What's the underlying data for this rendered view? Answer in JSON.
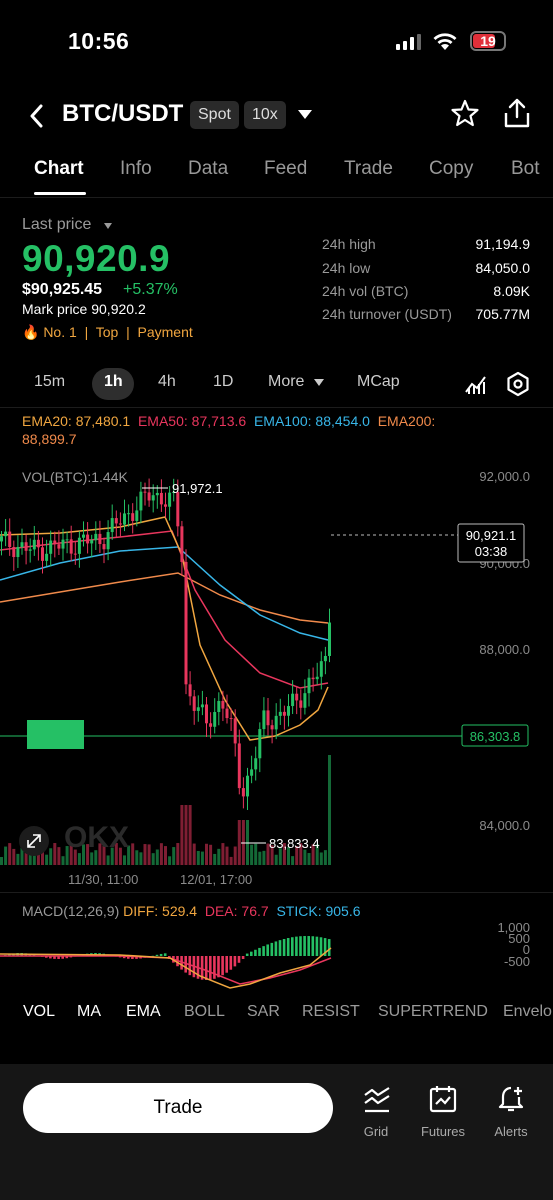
{
  "status_bar": {
    "time": "10:56",
    "battery": "19"
  },
  "header": {
    "pair": "BTC/USDT",
    "market_type": "Spot",
    "leverage": "10x"
  },
  "tabs": [
    "Chart",
    "Info",
    "Data",
    "Feed",
    "Trade",
    "Copy",
    "Bot"
  ],
  "ticker": {
    "last_price_label": "Last price",
    "last_price": "90,920.9",
    "usd_price": "$90,925.45",
    "change_pct": "+5.37%",
    "mark_price": "Mark price 90,920.2",
    "tags": "🔥 No. 1  |  Top  |  Payment",
    "stats": [
      {
        "label": "24h high",
        "value": "91,194.9"
      },
      {
        "label": "24h low",
        "value": "84,050.0"
      },
      {
        "label": "24h vol (BTC)",
        "value": "8.09K"
      },
      {
        "label": "24h turnover (USDT)",
        "value": "705.77M"
      }
    ]
  },
  "intervals": {
    "m15": "15m",
    "h1": "1h",
    "h4": "4h",
    "d1": "1D",
    "more": "More",
    "mcap": "MCap"
  },
  "indicators_legend": {
    "ema20": "EMA20: 87,480.1",
    "ema50": "EMA50: 87,713.6",
    "ema100": "EMA100: 88,454.0",
    "ema200_a": "EMA200:",
    "ema200_b": "88,899.7",
    "vol": "VOL(BTC):1.44K"
  },
  "chart": {
    "y_ticks": [
      "92,000.0",
      "90,000.0",
      "88,000.0",
      "84,000.0"
    ],
    "high_label": "91,972.1",
    "low_label": "83,833.4",
    "current_price": "90,921.1",
    "countdown": "03:38",
    "line_price": "86,303.8",
    "x_ticks": [
      "11/30, 11:00",
      "12/01, 17:00"
    ],
    "watermark": "OKX"
  },
  "macd": {
    "title": "MACD(12,26,9)",
    "diff": "DIFF: 529.4",
    "dea": "DEA: 76.7",
    "stick": "STICK: 905.6",
    "y_ticks": [
      "1,000",
      "500",
      "0",
      "-500"
    ]
  },
  "indicator_tabs": [
    "VOL",
    "MA",
    "EMA",
    "BOLL",
    "SAR",
    "RESIST",
    "SUPERTREND",
    "Envelo"
  ],
  "bottom": {
    "trade": "Trade",
    "grid": "Grid",
    "futures": "Futures",
    "alerts": "Alerts"
  },
  "colors": {
    "green": "#25c065",
    "red": "#e8365d",
    "ema20": "#f0a640",
    "ema50": "#e8365d",
    "ema100": "#38b6e8",
    "ema200": "#f08a4b",
    "diff": "#f0a640",
    "dea": "#e8365d",
    "stick": "#38b6e8"
  }
}
